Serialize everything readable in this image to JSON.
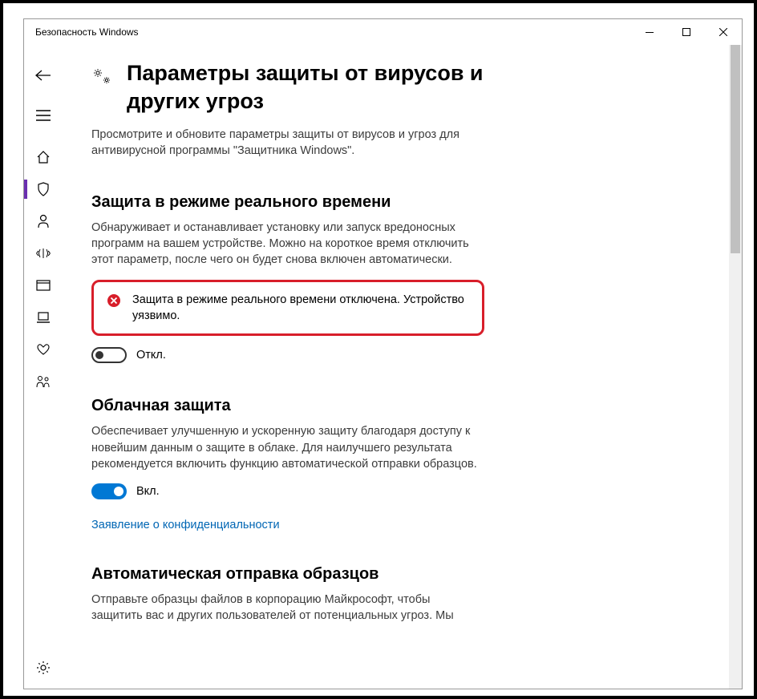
{
  "window": {
    "title": "Безопасность Windows"
  },
  "page": {
    "title": "Параметры защиты от вирусов и других угроз",
    "description": "Просмотрите и обновите параметры защиты от вирусов и угроз для антивирусной программы \"Защитника Windows\"."
  },
  "sections": {
    "realtime": {
      "title": "Защита в режиме реального времени",
      "description": "Обнаруживает и останавливает установку или запуск вредоносных программ на вашем устройстве. Можно на короткое время отключить этот параметр, после чего он будет снова включен автоматически.",
      "alert": "Защита в режиме реального времени отключена. Устройство уязвимо.",
      "toggle_label": "Откл."
    },
    "cloud": {
      "title": "Облачная защита",
      "description": "Обеспечивает улучшенную и ускоренную защиту благодаря доступу к новейшим данным о защите в облаке. Для наилучшего результата рекомендуется включить функцию автоматической отправки образцов.",
      "toggle_label": "Вкл.",
      "link": "Заявление о конфиденциальности"
    },
    "samples": {
      "title": "Автоматическая отправка образцов",
      "description": "Отправьте образцы файлов в корпорацию Майкрософт, чтобы защитить вас и других пользователей от потенциальных угроз. Мы"
    }
  }
}
